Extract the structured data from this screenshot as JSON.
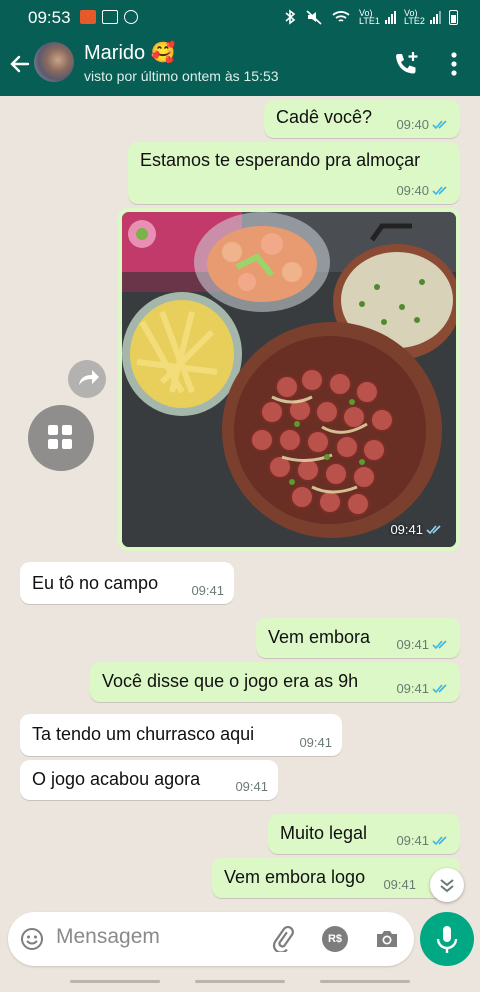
{
  "status_bar": {
    "time": "09:53",
    "sim1": "Vo) LTE1",
    "sim2": "Vo) LTE2"
  },
  "header": {
    "contact_name": "Marido 🥰",
    "status": "visto por último ontem às 15:53"
  },
  "messages": [
    {
      "text": "Cadê você?",
      "time": "09:40",
      "direction": "out",
      "read": true
    },
    {
      "text": "Estamos te esperando pra almoçar",
      "time": "09:40",
      "direction": "out",
      "read": true
    },
    {
      "type": "image",
      "time": "09:41",
      "direction": "out",
      "read": true
    },
    {
      "text": "Eu tô no campo",
      "time": "09:41",
      "direction": "in"
    },
    {
      "text": "Vem embora",
      "time": "09:41",
      "direction": "out",
      "read": true
    },
    {
      "text": "Você disse que o jogo era as 9h",
      "time": "09:41",
      "direction": "out",
      "read": true
    },
    {
      "text": "Ta tendo um churrasco aqui",
      "time": "09:41",
      "direction": "in"
    },
    {
      "text": "O jogo acabou agora",
      "time": "09:41",
      "direction": "in"
    },
    {
      "text": "Muito legal",
      "time": "09:41",
      "direction": "out",
      "read": true
    },
    {
      "text": "Vem embora logo",
      "time": "09:41",
      "direction": "out",
      "read": true
    }
  ],
  "input": {
    "placeholder": "Mensagem",
    "pay_label": "R$"
  },
  "colors": {
    "header": "#075e54",
    "outgoing_bubble": "#dcf8c6",
    "incoming_bubble": "#ffffff",
    "read_ticks": "#34b7f1",
    "mic_button": "#00a884",
    "wallpaper": "#ece5dd"
  },
  "icons": [
    "back-arrow-icon",
    "add-call-icon",
    "menu-dots-icon",
    "forward-icon",
    "gallery-icon",
    "scroll-down-icon",
    "emoji-icon",
    "attach-icon",
    "pay-icon",
    "camera-icon",
    "mic-icon"
  ]
}
